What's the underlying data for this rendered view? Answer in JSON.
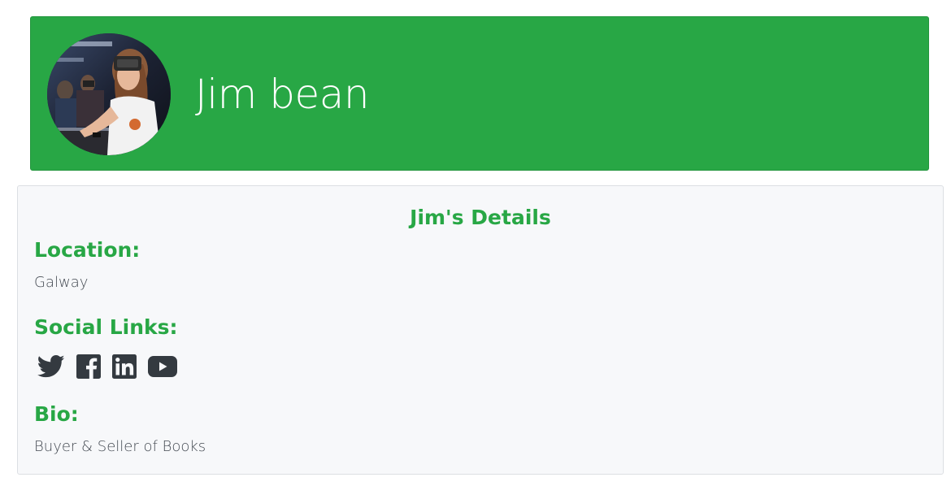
{
  "profile": {
    "name": "Jim bean",
    "avatar_icon": "avatar-photo-vr-headset"
  },
  "details": {
    "title": "Jim's Details",
    "location_label": "Location:",
    "location_value": "Galway",
    "social_label": "Social Links:",
    "social_links": [
      {
        "name": "twitter",
        "icon": "twitter-icon"
      },
      {
        "name": "facebook",
        "icon": "facebook-icon"
      },
      {
        "name": "linkedin",
        "icon": "linkedin-icon"
      },
      {
        "name": "youtube",
        "icon": "youtube-icon"
      }
    ],
    "bio_label": "Bio:",
    "bio_value": "Buyer & Seller of Books"
  },
  "colors": {
    "accent_green": "#28a745",
    "card_background": "#f7f8fa",
    "icon_dark": "#343a40",
    "text_muted": "#444a52"
  }
}
